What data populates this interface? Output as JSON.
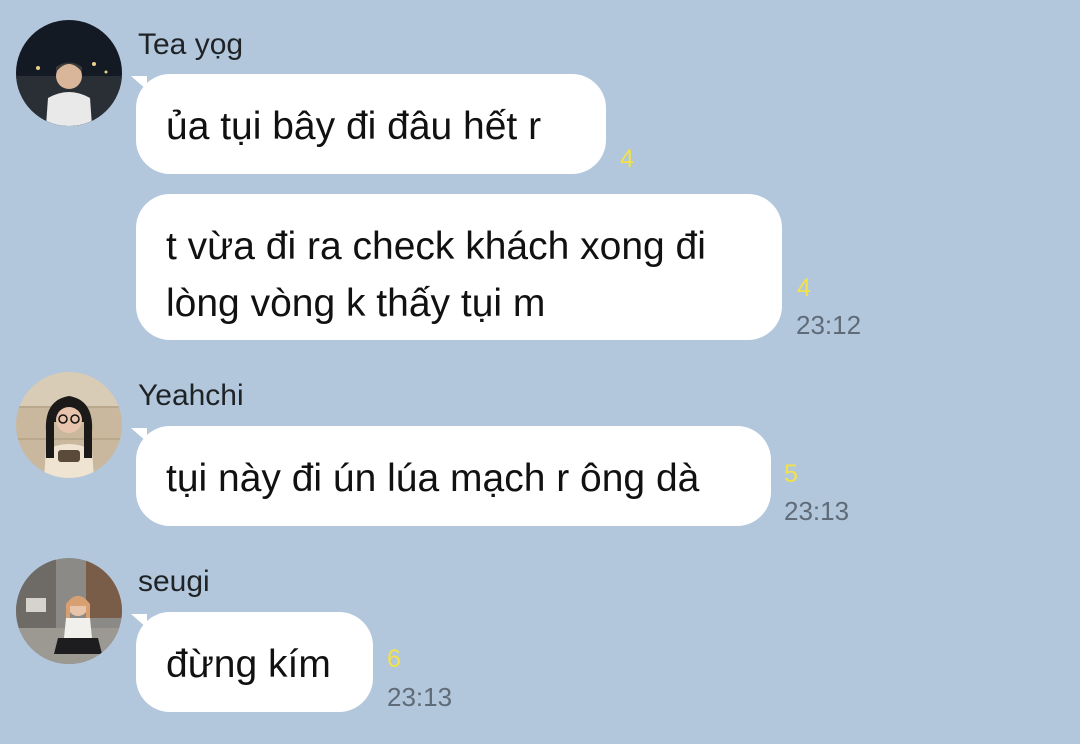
{
  "messages": [
    {
      "sender": "Tea yọg",
      "text": "ủa tụi bây đi đâu hết r",
      "unread": "4"
    },
    {
      "lines": [
        "t vừa đi ra check khách xong đi",
        "lòng vòng k thấy tụi m"
      ],
      "unread": "4",
      "time": "23:12"
    },
    {
      "sender": "Yeahchi",
      "text": "tụi này đi ún lúa mạch r ông dà",
      "unread": "5",
      "time": "23:13"
    },
    {
      "sender": "seugi",
      "text": "đừng kím",
      "unread": "6",
      "time": "23:13"
    }
  ]
}
